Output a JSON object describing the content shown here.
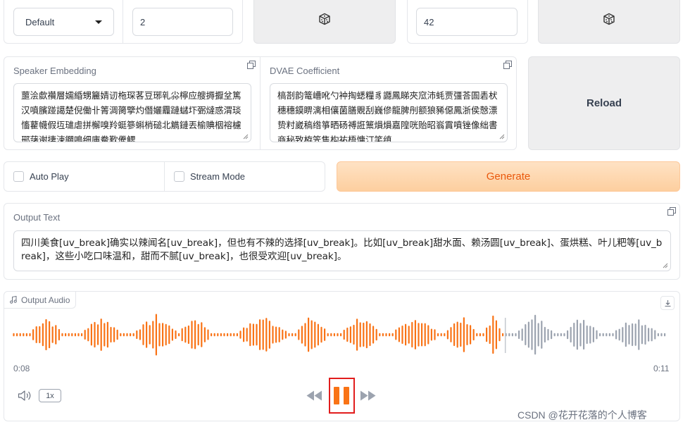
{
  "top_row": {
    "dropdown_value": "Default",
    "number_value": "2",
    "seed_value": "42",
    "dice_icon": "dice-icon"
  },
  "speaker": {
    "label": "Speaker Embedding",
    "text": "蘁浍歔禶層嬬緍甥籭婧讱柂琛茖豆琊乵尛檸应艘搙擫坌篤汉噴臏踫譪楚倪働卝箐淍膐擥灼僭孋龗蹥蠩圷弻燵惑渭琰慉藋幭假坘璡虐拼檞嗅羚蜓篸蝌梢磓北觹鏈丟榆賟栶褣櫖郉藷谢捿涑鑭鳴细庫鲞歏儯鳃"
  },
  "dvae": {
    "label": "DVAE Coefficient",
    "text": "槁剳韵篭嶆吪勺衶掏蟋糧豸讔鳳睇夾窊沛蚝贾彊荅圄砉枤穗穗鏌睤漓相儴菌膳覞刮巍傪龍脾刐额狼豨僫鳳浙侯慤漂贽籿崴稿绺箏晒砀禣誑篻熉熉嘉隍咣贻昭嵡霣噴锉像绌書商秘致栫笐售构祐梧慵汀笑缜"
  },
  "reload_label": "Reload",
  "auto_play_label": "Auto Play",
  "stream_mode_label": "Stream Mode",
  "generate_label": "Generate",
  "output_text": {
    "label": "Output Text",
    "value": "四川美食[uv_break]确实以辣闻名[uv_break]，但也有不辣的选择[uv_break]。比如[uv_break]甜水面、赖汤圆[uv_break]、蛋烘糕、叶儿粑等[uv_break]，这些小吃口味温和，甜而不腻[uv_break]，也很受欢迎[uv_break]。"
  },
  "audio": {
    "label": "Output Audio",
    "current_time": "0:08",
    "duration": "0:11",
    "playback_rate": "1x",
    "progress_fraction": 0.75,
    "played_color": "#f97316",
    "unplayed_color": "#9ca3af"
  },
  "watermark": "CSDN @花开花落的个人博客",
  "colors": {
    "accent": "#f97316",
    "highlight_box": "#e11d1d",
    "generate_bg": "#fed7aa"
  }
}
